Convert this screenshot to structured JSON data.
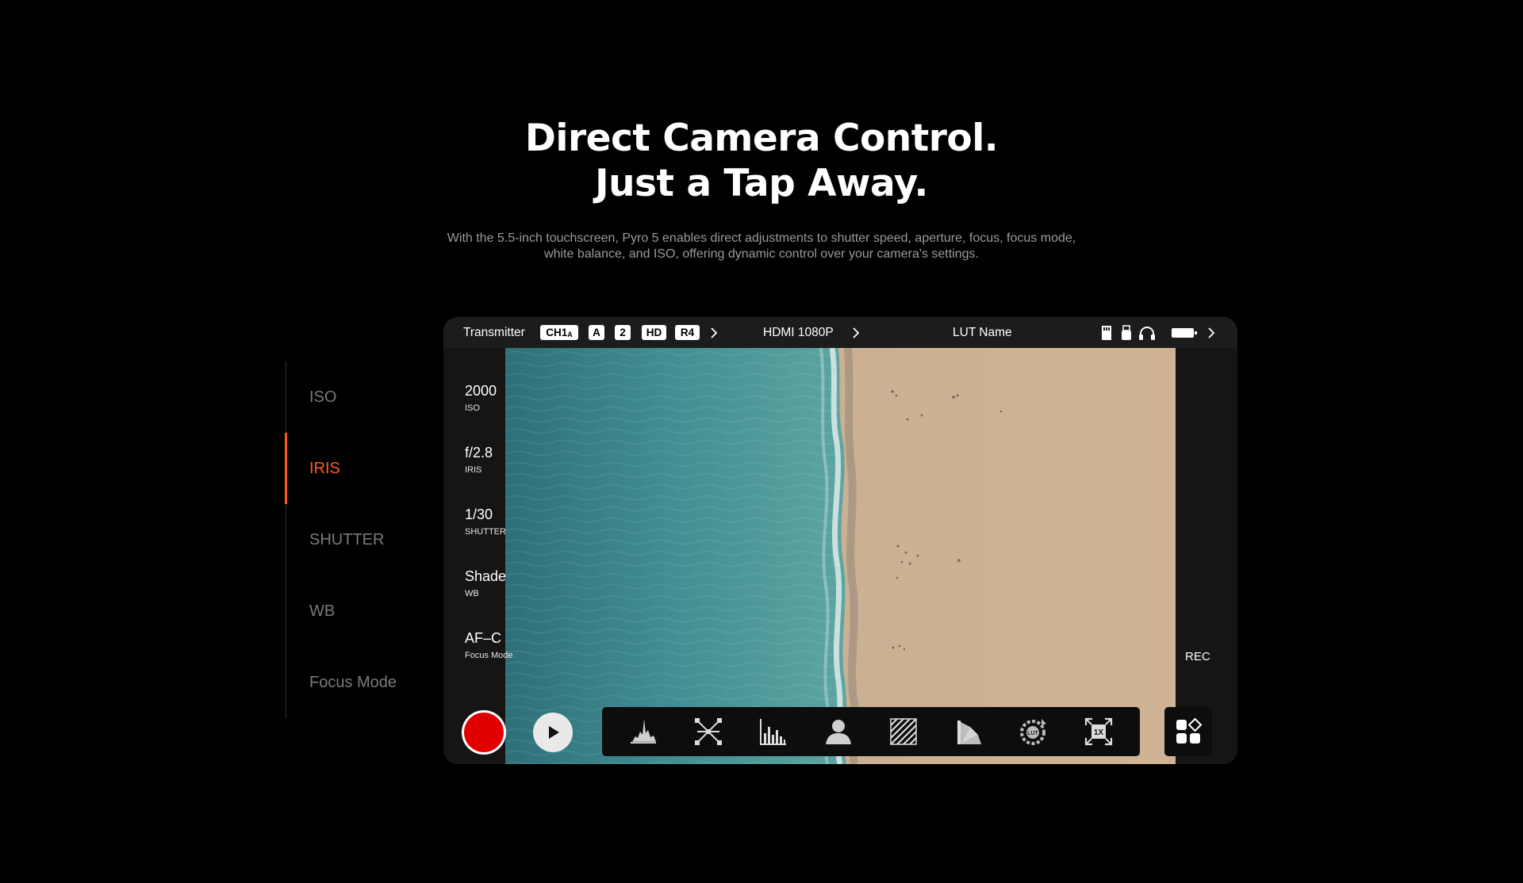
{
  "hero": {
    "title_line1": "Direct Camera Control.",
    "title_line2": "Just a Tap Away.",
    "subtitle_line1": "With the 5.5-inch touchscreen, Pyro 5 enables direct adjustments to shutter speed, aperture, focus, focus mode,",
    "subtitle_line2": "white balance, and ISO, offering dynamic control over your camera's settings."
  },
  "side_menu": {
    "items": [
      {
        "label": "ISO",
        "active": false
      },
      {
        "label": "IRIS",
        "active": true
      },
      {
        "label": "SHUTTER",
        "active": false
      },
      {
        "label": "WB",
        "active": false
      },
      {
        "label": "Focus Mode",
        "active": false
      }
    ]
  },
  "topbar": {
    "transmitter_label": "Transmitter",
    "chips": {
      "ch": "CH1",
      "ch_sub": "A",
      "a": "A",
      "two": "2",
      "hd": "HD",
      "r4": "R4"
    },
    "hdmi_label": "HDMI 1080P",
    "lut_label": "LUT Name",
    "icons": [
      "sd-card-icon",
      "usb-icon",
      "headphones-icon",
      "battery-icon",
      "chevron-right-icon"
    ]
  },
  "params": [
    {
      "value": "2000",
      "label": "ISO"
    },
    {
      "value": "f/2.8",
      "label": "IRIS"
    },
    {
      "value": "1/30",
      "label": "SHUTTER"
    },
    {
      "value": "Shade",
      "label": "WB"
    },
    {
      "value": "AF–C",
      "label": "Focus Mode"
    }
  ],
  "rec_label": "REC",
  "toolbar": {
    "tools": [
      "waveform-icon",
      "focus-peaking-icon",
      "histogram-icon",
      "false-color-icon",
      "zebra-icon",
      "vectorscope-icon",
      "lut-icon",
      "zoom-1x-icon"
    ],
    "zoom_label": "1X",
    "lut_text": "LUT"
  },
  "colors": {
    "accent": "#ff5a1f",
    "record": "#e00000"
  }
}
